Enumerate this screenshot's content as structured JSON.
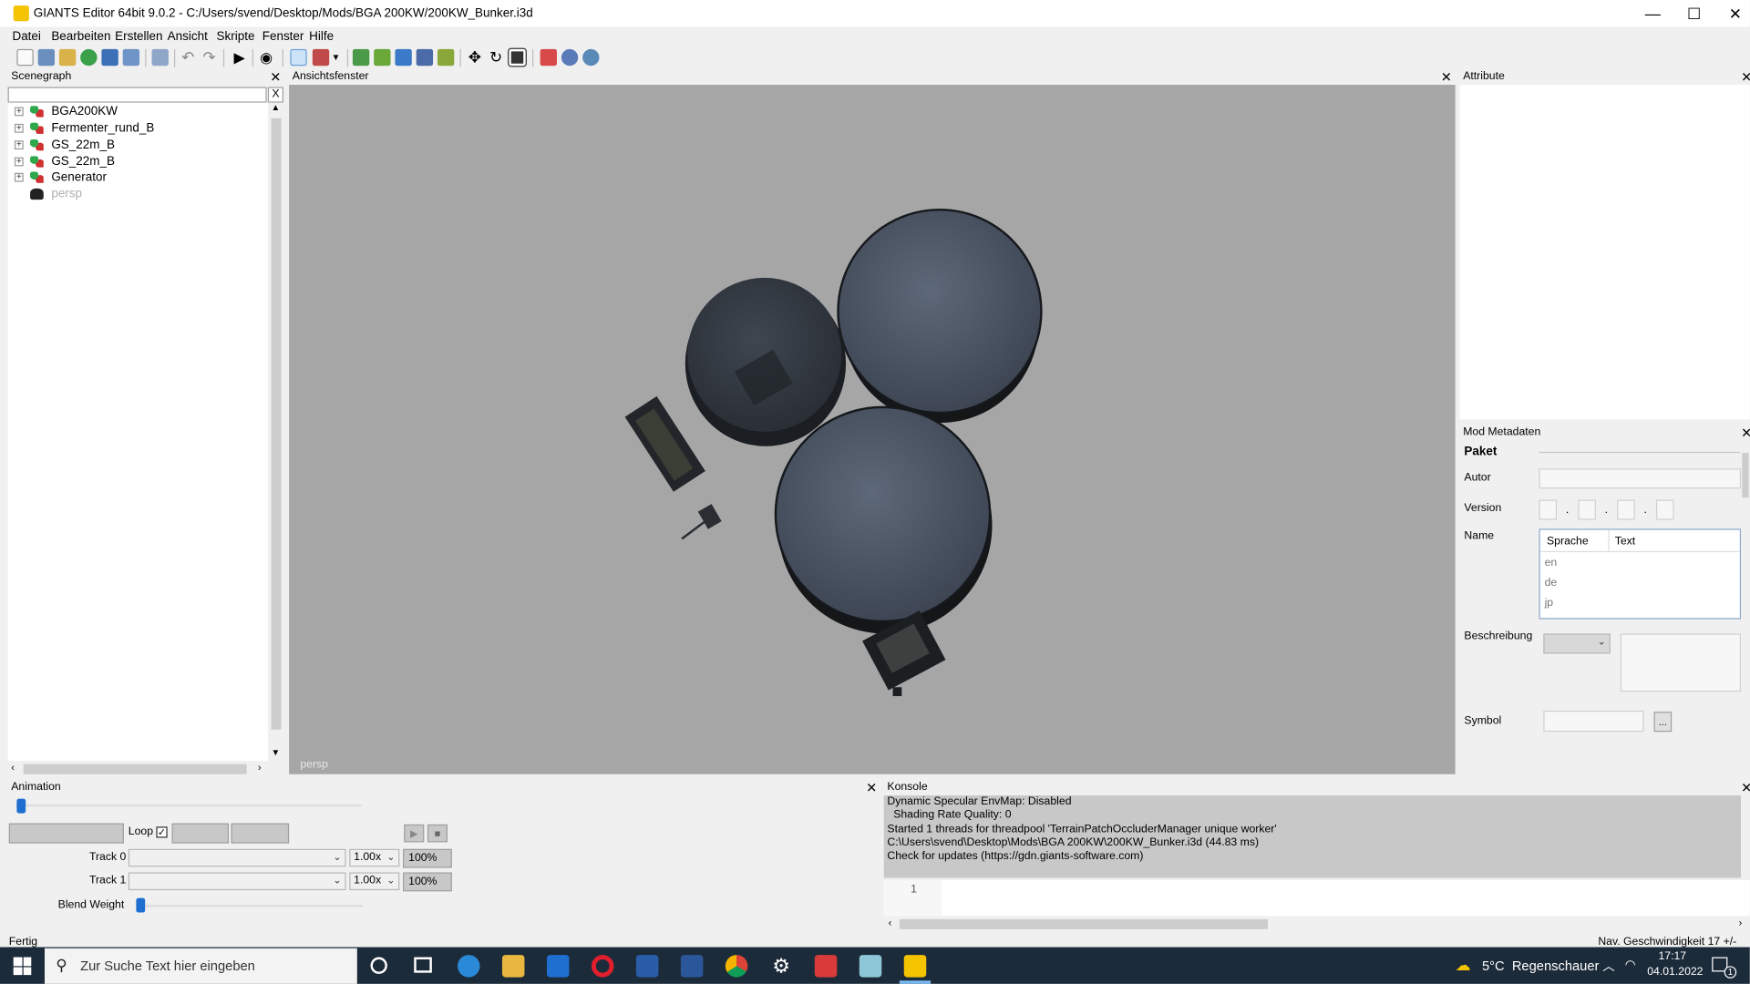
{
  "window": {
    "title": "GIANTS Editor 64bit 9.0.2 - C:/Users/svend/Desktop/Mods/BGA 200KW/200KW_Bunker.i3d",
    "minimize": "—",
    "maximize": "☐",
    "close": "✕"
  },
  "menu": {
    "items": [
      "Datei",
      "Bearbeiten",
      "Erstellen",
      "Ansicht",
      "Skripte",
      "Fenster",
      "Hilfe"
    ]
  },
  "scenegraph": {
    "title": "Scenegraph",
    "filter_clear": "X",
    "items": [
      {
        "label": "BGA200KW"
      },
      {
        "label": "Fermenter_rund_B"
      },
      {
        "label": "GS_22m_B"
      },
      {
        "label": "GS_22m_B"
      },
      {
        "label": "Generator"
      },
      {
        "label": "persp"
      }
    ]
  },
  "viewport": {
    "title": "Ansichtsfenster",
    "camera_label": "persp"
  },
  "attribute": {
    "title": "Attribute"
  },
  "metadata": {
    "title": "Mod Metadaten",
    "paket": "Paket",
    "autor": "Autor",
    "version": "Version",
    "name": "Name",
    "lang_col": "Sprache",
    "text_col": "Text",
    "langs": [
      "en",
      "de",
      "jp"
    ],
    "beschreibung": "Beschreibung",
    "symbol": "Symbol",
    "symbol_btn": "..."
  },
  "animation": {
    "title": "Animation",
    "loop": "Loop",
    "track0": "Track 0",
    "track1": "Track 1",
    "speed0": "1.00x",
    "speed1": "1.00x",
    "pct0": "100%",
    "pct1": "100%",
    "blend": "Blend Weight"
  },
  "console": {
    "title": "Konsole",
    "lines": [
      "Dynamic Specular EnvMap: Disabled",
      "  Shading Rate Quality: 0",
      "Started 1 threads for threadpool 'TerrainPatchOccluderManager unique worker'",
      "C:\\Users\\svend\\Desktop\\Mods\\BGA 200KW\\200KW_Bunker.i3d (44.83 ms)",
      "Check for updates (https://gdn.giants-software.com)"
    ],
    "line_number": "1"
  },
  "status": {
    "left": "Fertig",
    "right": "Nav. Geschwindigkeit 17 +/-"
  },
  "taskbar": {
    "search_placeholder": "Zur Suche Text hier eingeben",
    "weather": "5°C  Regenschauer",
    "time": "17:17",
    "date": "04.01.2022",
    "notif": "1"
  },
  "colors": {
    "viewport_bg": "#a6a6a6",
    "taskbar": "#1c2b3a",
    "console_bg": "#c8c8c8"
  }
}
